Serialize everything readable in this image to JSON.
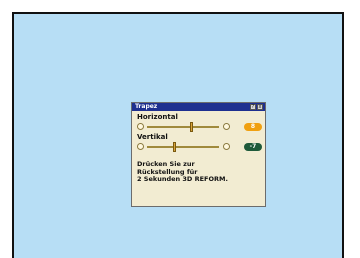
{
  "dialog": {
    "title": "Trapez",
    "title_buttons": [
      "?",
      "x"
    ],
    "horizontal": {
      "label": "Horizontal",
      "value": "8",
      "level": 0.62
    },
    "vertikal": {
      "label": "Vertikal",
      "value": "-7",
      "level": 0.38
    },
    "message_lines": [
      "Drücken Sie zur",
      "Rückstellung für",
      "2 Sekunden 3D REFORM."
    ]
  },
  "colors": {
    "screen": "#b7def5",
    "titlebar": "#1e2f8f",
    "panel": "#f2ecd2",
    "value_active": "#f0a010",
    "value_inactive": "#1f5a3a"
  }
}
